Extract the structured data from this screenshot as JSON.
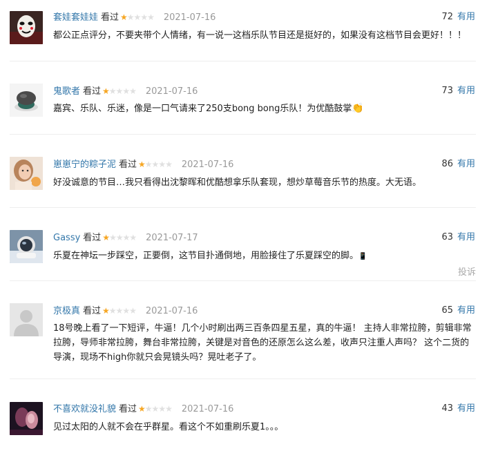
{
  "comments": [
    {
      "username": "套娃套娃娃",
      "status": "看过",
      "rating": 1,
      "date": "2021-07-16",
      "votes": "72",
      "vote_label": "有用",
      "content": "都公正点评分，不要夹带个人情绪，有一说一这档乐队节目还是挺好的，如果没有这档节目会更好！！！",
      "avatar_icon": "mask-face-avatar-icon"
    },
    {
      "username": "鬼歌者",
      "status": "看过",
      "rating": 1,
      "date": "2021-07-16",
      "votes": "73",
      "vote_label": "有用",
      "content": "嘉宾、乐队、乐迷，像是一口气请来了250支bong bong乐队！为优酷鼓掌",
      "emoji": "👏",
      "avatar_icon": "stone-object-avatar-icon"
    },
    {
      "username": "崽崽宁的粽子泥",
      "status": "看过",
      "rating": 1,
      "date": "2021-07-16",
      "votes": "86",
      "vote_label": "有用",
      "content": "好没诚意的节目…我只看得出沈黎晖和优酷想拿乐队套现，想炒草莓音乐节的热度。大无语。",
      "avatar_icon": "girl-photo-avatar-icon"
    },
    {
      "username": "Gassy",
      "status": "看过",
      "rating": 1,
      "date": "2021-07-17",
      "votes": "63",
      "vote_label": "有用",
      "content": "乐夏在神坛一步踩空，正要倒，这节目扑通倒地，用脸接住了乐夏踩空的脚。",
      "emoji": "📱",
      "report_label": "投诉",
      "avatar_icon": "astronaut-avatar-icon"
    },
    {
      "username": "京极真",
      "status": "看过",
      "rating": 1,
      "date": "2021-07-16",
      "votes": "65",
      "vote_label": "有用",
      "content": "18号晚上看了一下短评，牛逼！几个小时刷出两三百条四星五星，真的牛逼！ 主持人非常拉胯，剪辑非常拉胯，导师非常拉胯，舞台非常拉胯，关键是对音色的还原怎么这么差，收声只注重人声吗？ 这个二货的导演，现场不high你就只会晃镜头吗？晃吐老子了。",
      "avatar_icon": "default-user-avatar-icon"
    },
    {
      "username": "不喜欢就没礼貌",
      "status": "看过",
      "rating": 1,
      "date": "2021-07-16",
      "votes": "43",
      "vote_label": "有用",
      "content": "见过太阳的人就不会在乎群星。看这个不如重刷乐夏1。。。",
      "avatar_icon": "dark-photo-avatar-icon"
    }
  ],
  "max_rating": 5,
  "colors": {
    "link": "#3377aa",
    "star_on": "#f6a623",
    "star_off": "#e0e0e0",
    "muted": "#999999"
  }
}
